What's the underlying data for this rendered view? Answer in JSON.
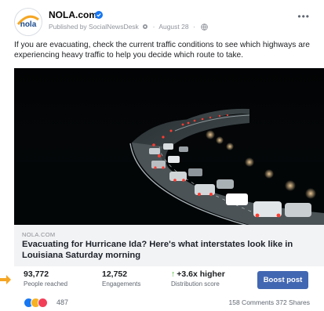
{
  "post": {
    "page_name": "NOLA.com",
    "avatar_text": "nola",
    "published_by": "Published by SocialNewsDesk",
    "date": "August 28",
    "text": "If you are evacuating, check the current traffic conditions to see which highways are experiencing heavy traffic to help you decide which route to take.",
    "more_label": "•••"
  },
  "link": {
    "domain": "NOLA.COM",
    "headline": "Evacuating for Hurricane Ida? Here's what interstates look like in Louisiana Saturday morning"
  },
  "stats": [
    {
      "value": "93,772",
      "label": "People reached"
    },
    {
      "value": "12,752",
      "label": "Engagements"
    },
    {
      "value": "+3.6x higher",
      "label": "Distribution score"
    }
  ],
  "boost_label": "Boost post",
  "footer": {
    "reaction_count": "487",
    "engagement": "158 Comments  372 Shares"
  },
  "colors": {
    "brand_blue": "#4267b2",
    "increase_green": "#42b72a",
    "nola_orange": "#f5a623"
  },
  "icons": {
    "verified": "verified-badge-icon",
    "gear": "gear-icon",
    "globe": "globe-icon",
    "pointer": "pointer-arrow-icon"
  }
}
